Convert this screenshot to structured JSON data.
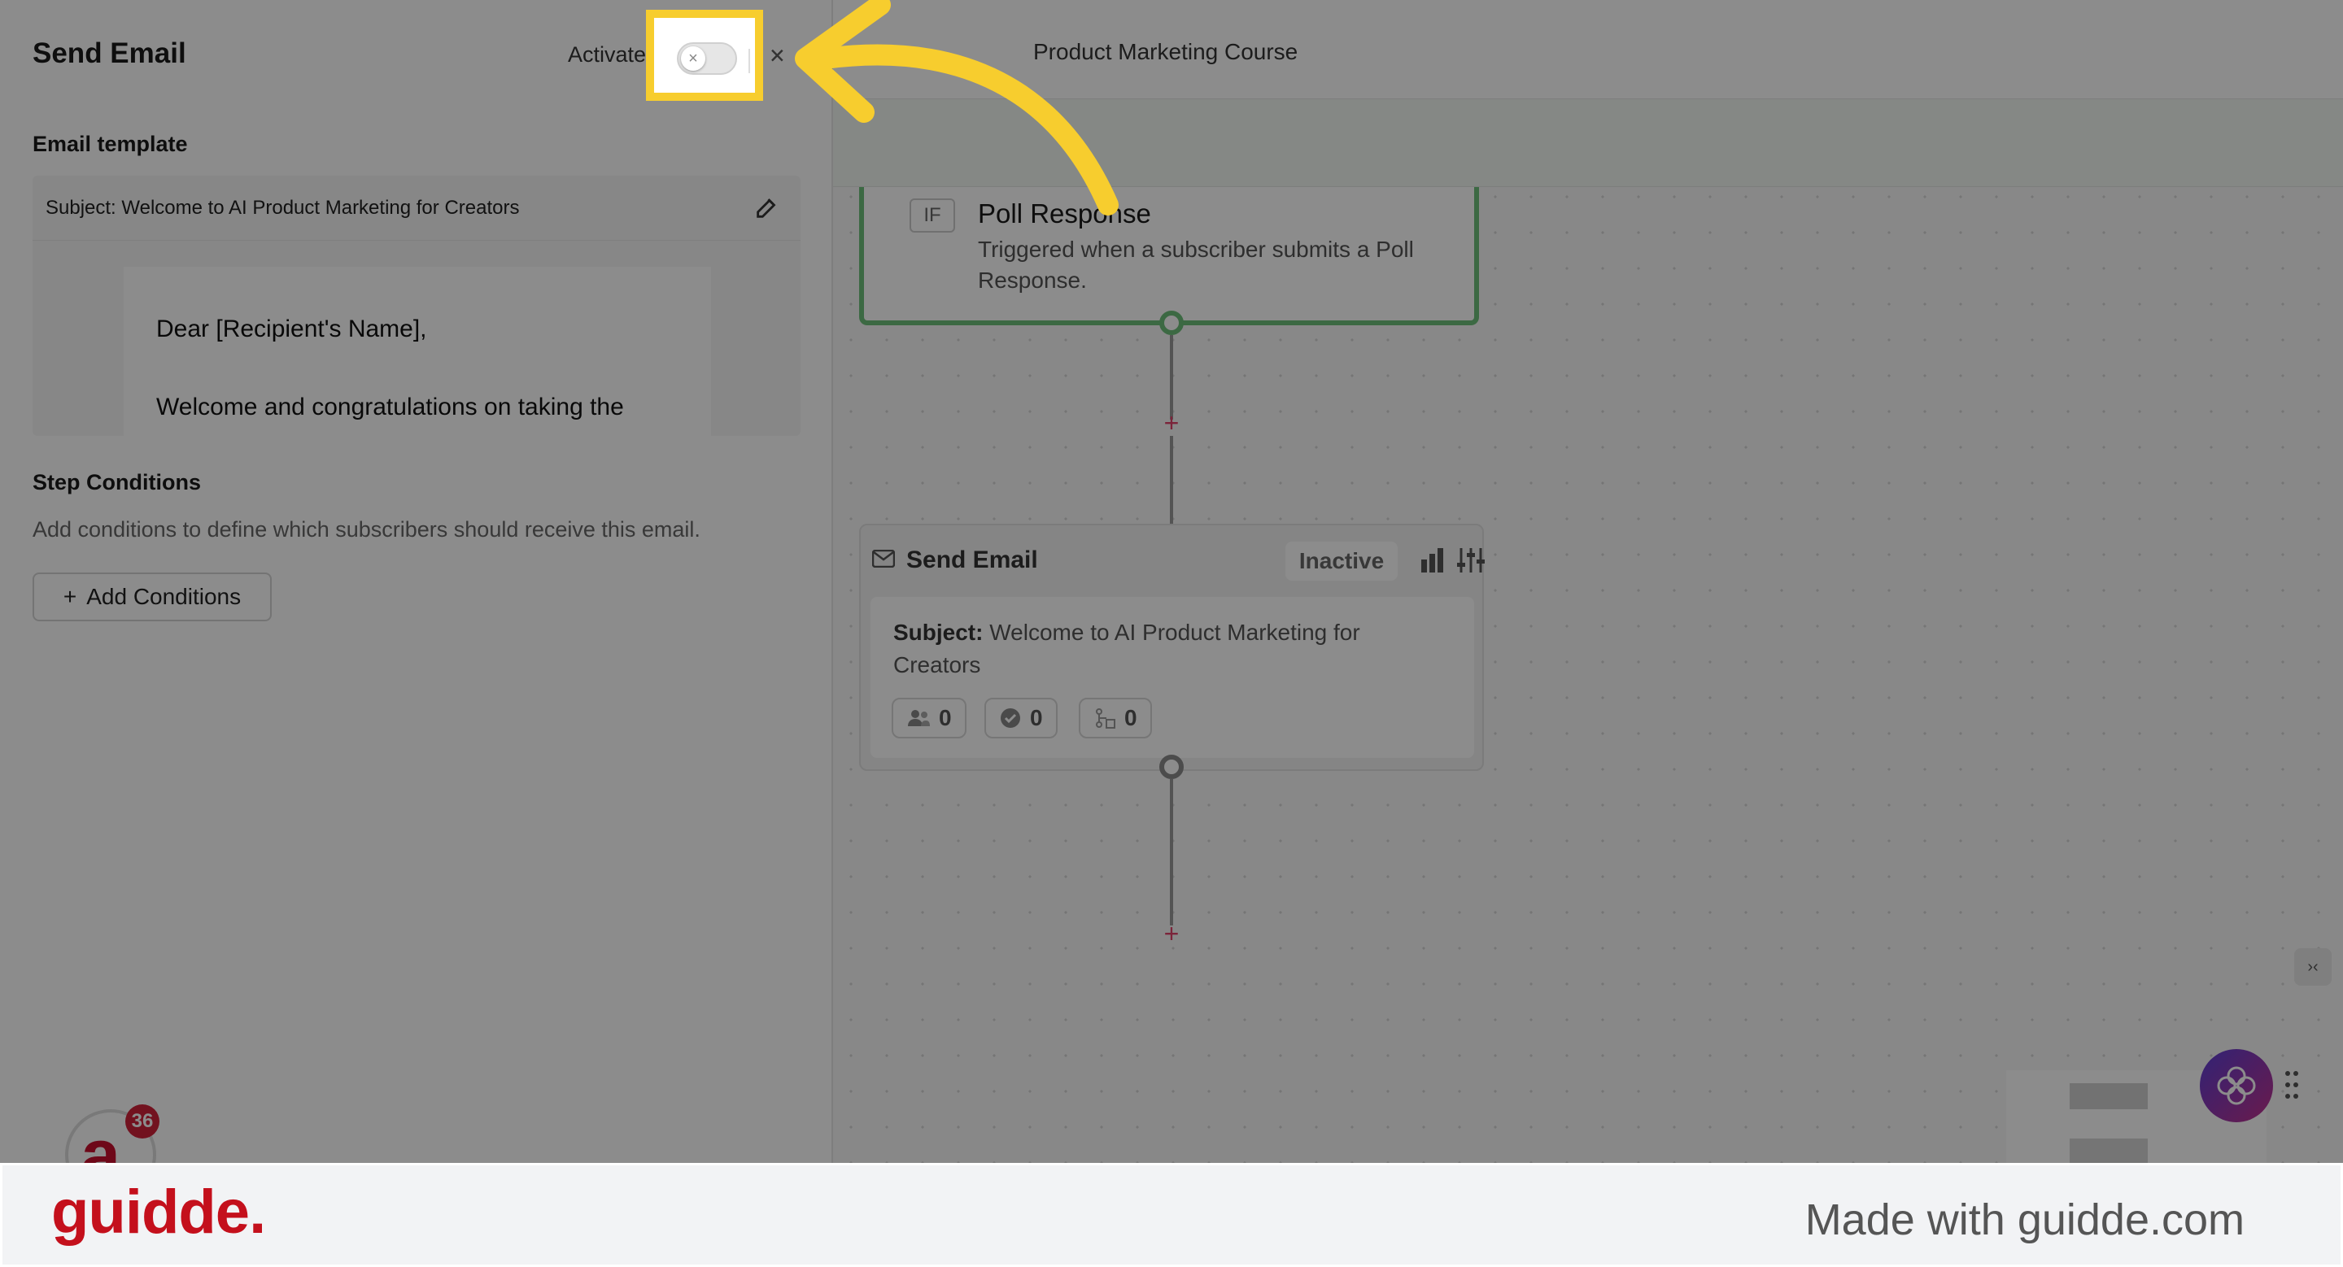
{
  "panel": {
    "title": "Send Email",
    "activate_label": "Activate",
    "toggle_icon": "x-icon",
    "close_icon": "×"
  },
  "email_template": {
    "label": "Email template",
    "subject": "Subject: Welcome to AI Product Marketing for Creators",
    "preview_lines": [
      "Dear [Recipient's Name],",
      "Welcome and congratulations on taking the"
    ]
  },
  "step_conditions": {
    "label": "Step Conditions",
    "description": "Add conditions to define which subscribers should receive this email.",
    "add_button": "Add Conditions",
    "add_icon": "+"
  },
  "canvas": {
    "title": "Product Marketing Course",
    "trigger": {
      "badge": "IF",
      "title": "Poll Response",
      "description": "Triggered when a subscriber submits a Poll Response."
    },
    "email_node": {
      "title": "Send Email",
      "status": "Inactive",
      "subject_label": "Subject:",
      "subject_value": "Welcome to AI Product Marketing for Creators",
      "stats": [
        "0",
        "0",
        "0"
      ]
    },
    "plus_symbol": "+",
    "collapse_icon": "›‹"
  },
  "notifications": {
    "count": "36",
    "avatar_letter": "a."
  },
  "footer": {
    "brand": "guidde.",
    "made_with": "Made with guidde.com"
  },
  "colors": {
    "highlight": "#f7cd2e",
    "brand": "#c4101c",
    "trigger_border": "#6dc07a",
    "plus": "#e0426b"
  }
}
